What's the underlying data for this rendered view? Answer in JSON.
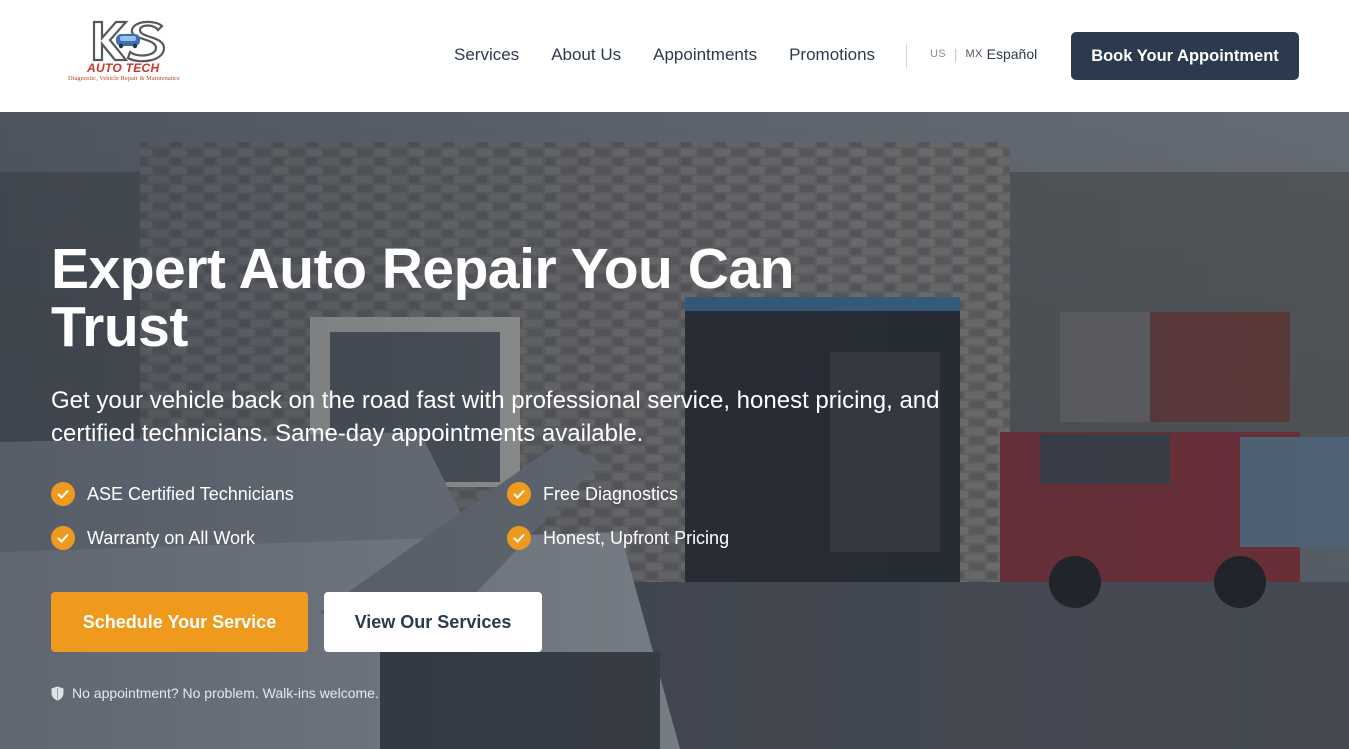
{
  "brand": {
    "logo_text": "KS",
    "logo_sub_title": "AUTO TECH",
    "logo_tagline": "Diagnostic, Vehicle Repair & Maintenance"
  },
  "nav": {
    "items": [
      {
        "label": "Services"
      },
      {
        "label": "About Us"
      },
      {
        "label": "Appointments"
      },
      {
        "label": "Promotions"
      }
    ]
  },
  "language": {
    "us_label": "US",
    "separator": "|",
    "es_flag": "MX",
    "es_label": "Español"
  },
  "header": {
    "book_button": "Book Your Appointment"
  },
  "hero": {
    "title": "Expert Auto Repair You Can Trust",
    "subtitle": "Get your vehicle back on the road fast with professional service, honest pricing, and certified technicians. Same-day appointments available.",
    "features": [
      {
        "label": "ASE Certified Technicians"
      },
      {
        "label": "Free Diagnostics"
      },
      {
        "label": "Warranty on All Work"
      },
      {
        "label": "Honest, Upfront Pricing"
      }
    ],
    "primary_button": "Schedule Your Service",
    "secondary_button": "View Our Services",
    "walkin_note": "No appointment? No problem. Walk-ins welcome."
  },
  "colors": {
    "navy": "#2b3a4d",
    "accent_orange": "#ef9a1c",
    "white": "#ffffff"
  },
  "icons": {
    "check": "check-circle-icon",
    "shield": "shield-icon"
  }
}
